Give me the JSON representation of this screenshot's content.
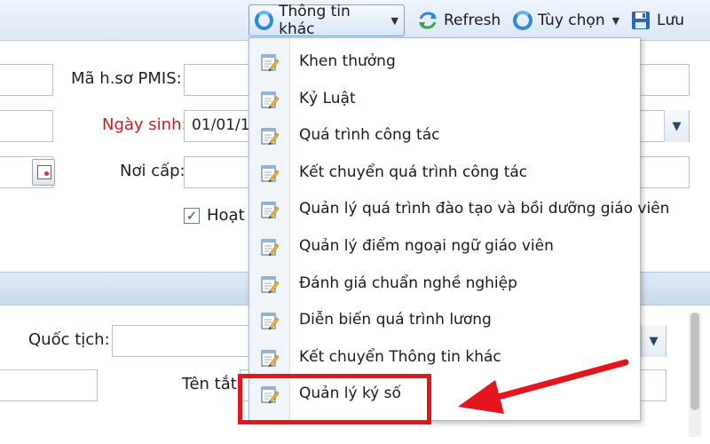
{
  "toolbar": {
    "other_info_label": "Thông tin khác",
    "refresh_label": "Refresh",
    "options_label": "Tùy chọn",
    "save_label": "Lưu"
  },
  "form": {
    "pmis_label": "Mã h.sơ PMIS:",
    "birth_label": "Ngày sinh:",
    "birth_value": "01/01/1",
    "issue_place_label": "Nơi cấp:",
    "active_label": "Hoạt",
    "nationality_label": "Quốc tịch:",
    "short_name_label": "Tên tắt"
  },
  "menu": {
    "items": [
      {
        "label": "Khen thưởng"
      },
      {
        "label": "Kỷ Luật"
      },
      {
        "label": "Quá trình công tác"
      },
      {
        "label": "Kết chuyển quá trình công tác"
      },
      {
        "label": "Quản lý quá trình đào tạo và bồi dưỡng giáo viên"
      },
      {
        "label": "Quản lý điểm ngoại ngữ giáo viên"
      },
      {
        "label": "Đánh giá chuẩn nghề nghiệp"
      },
      {
        "label": "Diễn biến quá trình lương"
      },
      {
        "label": "Kết chuyển Thông tin khác"
      },
      {
        "label": "Quản lý ký số"
      }
    ]
  },
  "colors": {
    "highlight": "#e3161d",
    "accent": "#2f87d8",
    "required_label": "#d11a1a"
  },
  "icons": {
    "menu_item": "edit-note-icon",
    "other_info": "ring-icon",
    "refresh": "refresh-icon",
    "options": "ring-icon",
    "save": "floppy-disk-icon"
  }
}
